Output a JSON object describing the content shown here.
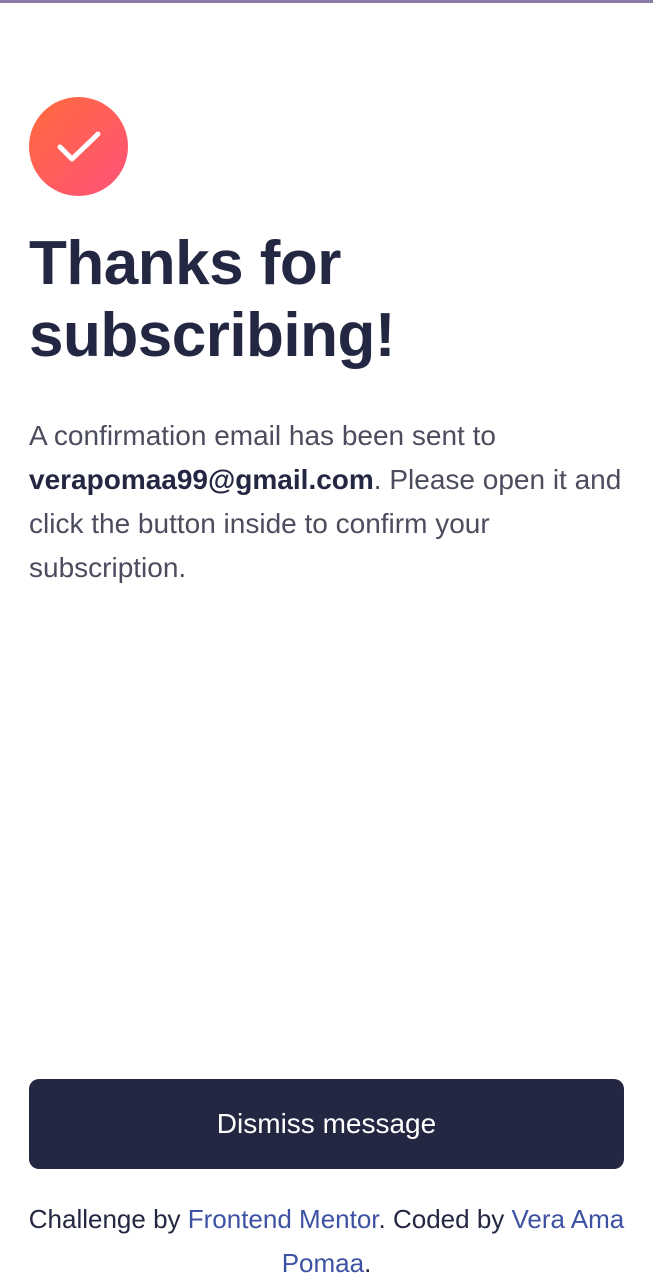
{
  "icon": {
    "name": "checkmark-icon",
    "gradient": [
      "#ff6a3a",
      "#ff527b"
    ]
  },
  "title": "Thanks for subscribing!",
  "message": {
    "before": "A confirmation email has been sent to ",
    "email": "verapomaa99@gmail.com",
    "after": ". Please open it and click the button inside to confirm your subscription."
  },
  "dismiss_button": {
    "label": "Dismiss message",
    "bg": "#242742"
  },
  "attribution": {
    "prefix": "Challenge by ",
    "mentor_link": "Frontend Mentor",
    "middle": ". Coded by ",
    "author_link": "Vera Ama Pomaa",
    "suffix": ".",
    "link_color": "#3e52a3"
  }
}
